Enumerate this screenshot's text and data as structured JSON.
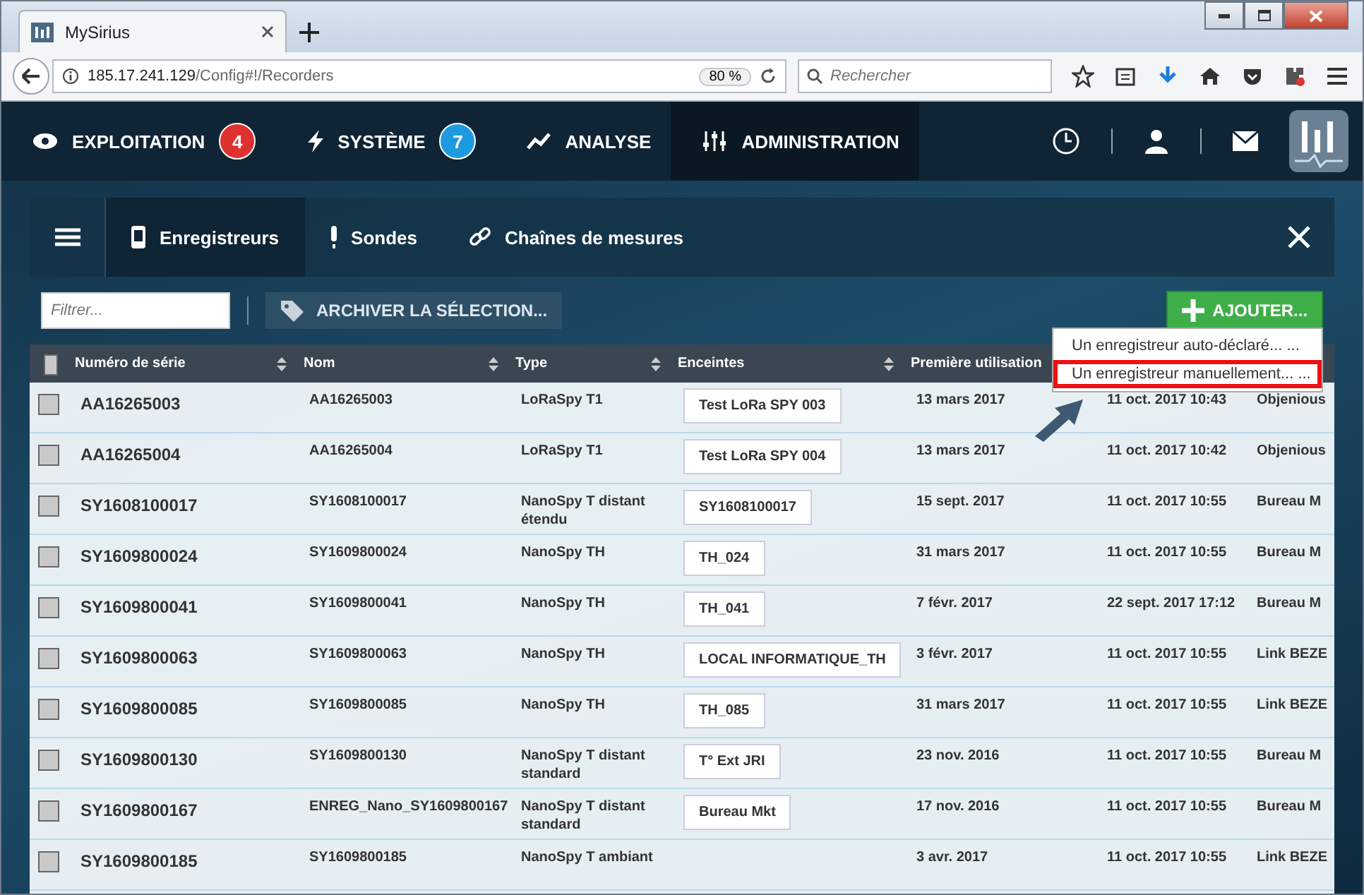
{
  "browser": {
    "tab_title": "MySirius",
    "url_host": "185.17.241.129",
    "url_path": "/Config#!/Recorders",
    "zoom": "80 %",
    "search_placeholder": "Rechercher"
  },
  "app_nav": [
    {
      "label": "EXPLOITATION",
      "selected": false,
      "badge": "4",
      "color": "#e03131"
    },
    {
      "label": "SYSTÈME",
      "selected": false,
      "badge": "7",
      "color": "#1e9be0"
    },
    {
      "label": "ANALYSE",
      "selected": false
    },
    {
      "label": "ADMINISTRATION",
      "selected": true
    }
  ],
  "sub_tabs": [
    {
      "label": "Enregistreurs",
      "selected": true
    },
    {
      "label": "Sondes",
      "selected": false
    },
    {
      "label": "Chaînes de mesures",
      "selected": false
    }
  ],
  "toolbar": {
    "filter_placeholder": "Filtrer...",
    "archive_label": "ARCHIVER LA SÉLECTION...",
    "add_label": "AJOUTER..."
  },
  "add_menu": [
    {
      "label": "Un enregistreur auto-déclaré... ...",
      "annotated": false
    },
    {
      "label": "Un enregistreur manuellement... ...",
      "annotated": true
    }
  ],
  "table": {
    "select_all_checked": false,
    "columns": [
      "Numéro de série",
      "Nom",
      "Type",
      "Enceintes",
      "Première utilisation"
    ],
    "rows": [
      {
        "checked": false,
        "serial": "AA16265003",
        "name": "AA16265003",
        "type": "LoRaSpy T1",
        "enclosure": "Test LoRa SPY 003",
        "first_use": "13 mars 2017",
        "column_6": "11 oct. 2017 10:43",
        "column_7": "Objenious"
      },
      {
        "checked": false,
        "serial": "AA16265004",
        "name": "AA16265004",
        "type": "LoRaSpy T1",
        "enclosure": "Test LoRa SPY 004",
        "first_use": "13 mars 2017",
        "column_6": "11 oct. 2017 10:42",
        "column_7": "Objenious"
      },
      {
        "checked": false,
        "serial": "SY1608100017",
        "name": "SY1608100017",
        "type": "NanoSpy T distant étendu",
        "enclosure": "SY1608100017",
        "first_use": "15 sept. 2017",
        "column_6": "11 oct. 2017 10:55",
        "column_7": "Bureau M"
      },
      {
        "checked": false,
        "serial": "SY1609800024",
        "name": "SY1609800024",
        "type": "NanoSpy TH",
        "enclosure": "TH_024",
        "first_use": "31 mars 2017",
        "column_6": "11 oct. 2017 10:55",
        "column_7": "Bureau M"
      },
      {
        "checked": false,
        "serial": "SY1609800041",
        "name": "SY1609800041",
        "type": "NanoSpy TH",
        "enclosure": "TH_041",
        "first_use": "7 févr. 2017",
        "column_6": "22 sept. 2017 17:12",
        "column_7": "Bureau M"
      },
      {
        "checked": false,
        "serial": "SY1609800063",
        "name": "SY1609800063",
        "type": "NanoSpy TH",
        "enclosure": "LOCAL INFORMATIQUE_TH",
        "first_use": "3 févr. 2017",
        "column_6": "11 oct. 2017 10:55",
        "column_7": "Link BEZE"
      },
      {
        "checked": false,
        "serial": "SY1609800085",
        "name": "SY1609800085",
        "type": "NanoSpy TH",
        "enclosure": "TH_085",
        "first_use": "31 mars 2017",
        "column_6": "11 oct. 2017 10:55",
        "column_7": "Link BEZE"
      },
      {
        "checked": false,
        "serial": "SY1609800130",
        "name": "SY1609800130",
        "type": "NanoSpy T distant standard",
        "enclosure": "T° Ext JRI",
        "first_use": "23 nov. 2016",
        "column_6": "11 oct. 2017 10:55",
        "column_7": "Bureau M"
      },
      {
        "checked": false,
        "serial": "SY1609800167",
        "name": "ENREG_Nano_SY1609800167",
        "type": "NanoSpy T distant standard",
        "enclosure": "Bureau Mkt",
        "first_use": "17 nov. 2016",
        "column_6": "11 oct. 2017 10:55",
        "column_7": "Bureau M"
      },
      {
        "checked": false,
        "serial": "SY1609800185",
        "name": "SY1609800185",
        "type": "NanoSpy T ambiant",
        "first_use": "3 avr. 2017",
        "column_6": "11 oct. 2017 10:55",
        "column_7": "Link BEZE"
      }
    ]
  }
}
